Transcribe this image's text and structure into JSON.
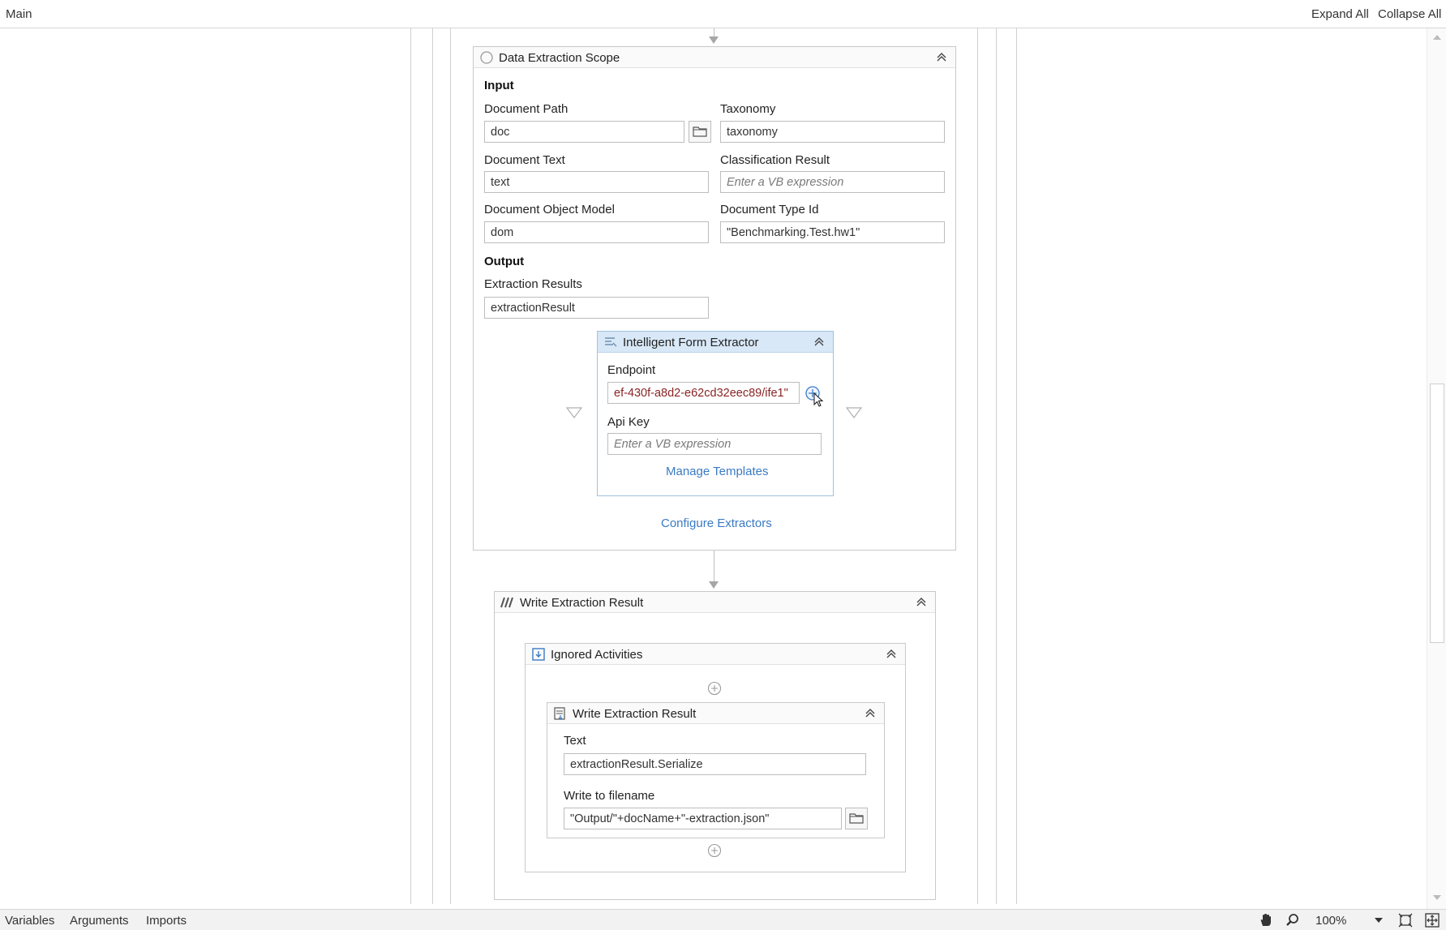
{
  "header": {
    "title": "Main",
    "expand_all": "Expand All",
    "collapse_all": "Collapse All"
  },
  "data_extraction_scope": {
    "title": "Data Extraction Scope",
    "input_label": "Input",
    "output_label": "Output",
    "document_path": {
      "label": "Document Path",
      "value": "doc"
    },
    "taxonomy": {
      "label": "Taxonomy",
      "value": "taxonomy"
    },
    "document_text": {
      "label": "Document Text",
      "value": "text"
    },
    "classification_result": {
      "label": "Classification Result",
      "placeholder": "Enter a VB expression"
    },
    "document_object_model": {
      "label": "Document Object Model",
      "value": "dom"
    },
    "document_type_id": {
      "label": "Document Type Id",
      "value": "\"Benchmarking.Test.hw1\""
    },
    "extraction_results": {
      "label": "Extraction Results",
      "value": "extractionResult"
    },
    "configure_extractors": "Configure Extractors"
  },
  "intelligent_form_extractor": {
    "title": "Intelligent Form Extractor",
    "endpoint": {
      "label": "Endpoint",
      "value": "ef-430f-a8d2-e62cd32eec89/ife1\""
    },
    "api_key": {
      "label": "Api Key",
      "placeholder": "Enter a VB expression"
    },
    "manage_templates": "Manage Templates"
  },
  "write_extraction_result_outer": {
    "title": "Write Extraction Result"
  },
  "ignored_activities": {
    "title": "Ignored Activities"
  },
  "write_extraction_result_inner": {
    "title": "Write Extraction Result",
    "text": {
      "label": "Text",
      "value": "extractionResult.Serialize"
    },
    "filename": {
      "label": "Write to filename",
      "value": "\"Output/\"+docName+\"-extraction.json\""
    }
  },
  "statusbar": {
    "variables": "Variables",
    "arguments": "Arguments",
    "imports": "Imports",
    "zoom": "100%"
  },
  "icons": [
    "pan-hand-icon",
    "zoom-search-icon",
    "fit-to-screen-icon",
    "overview-icon",
    "folder-icon",
    "collapse-chevron-icon",
    "add-activity-icon"
  ]
}
